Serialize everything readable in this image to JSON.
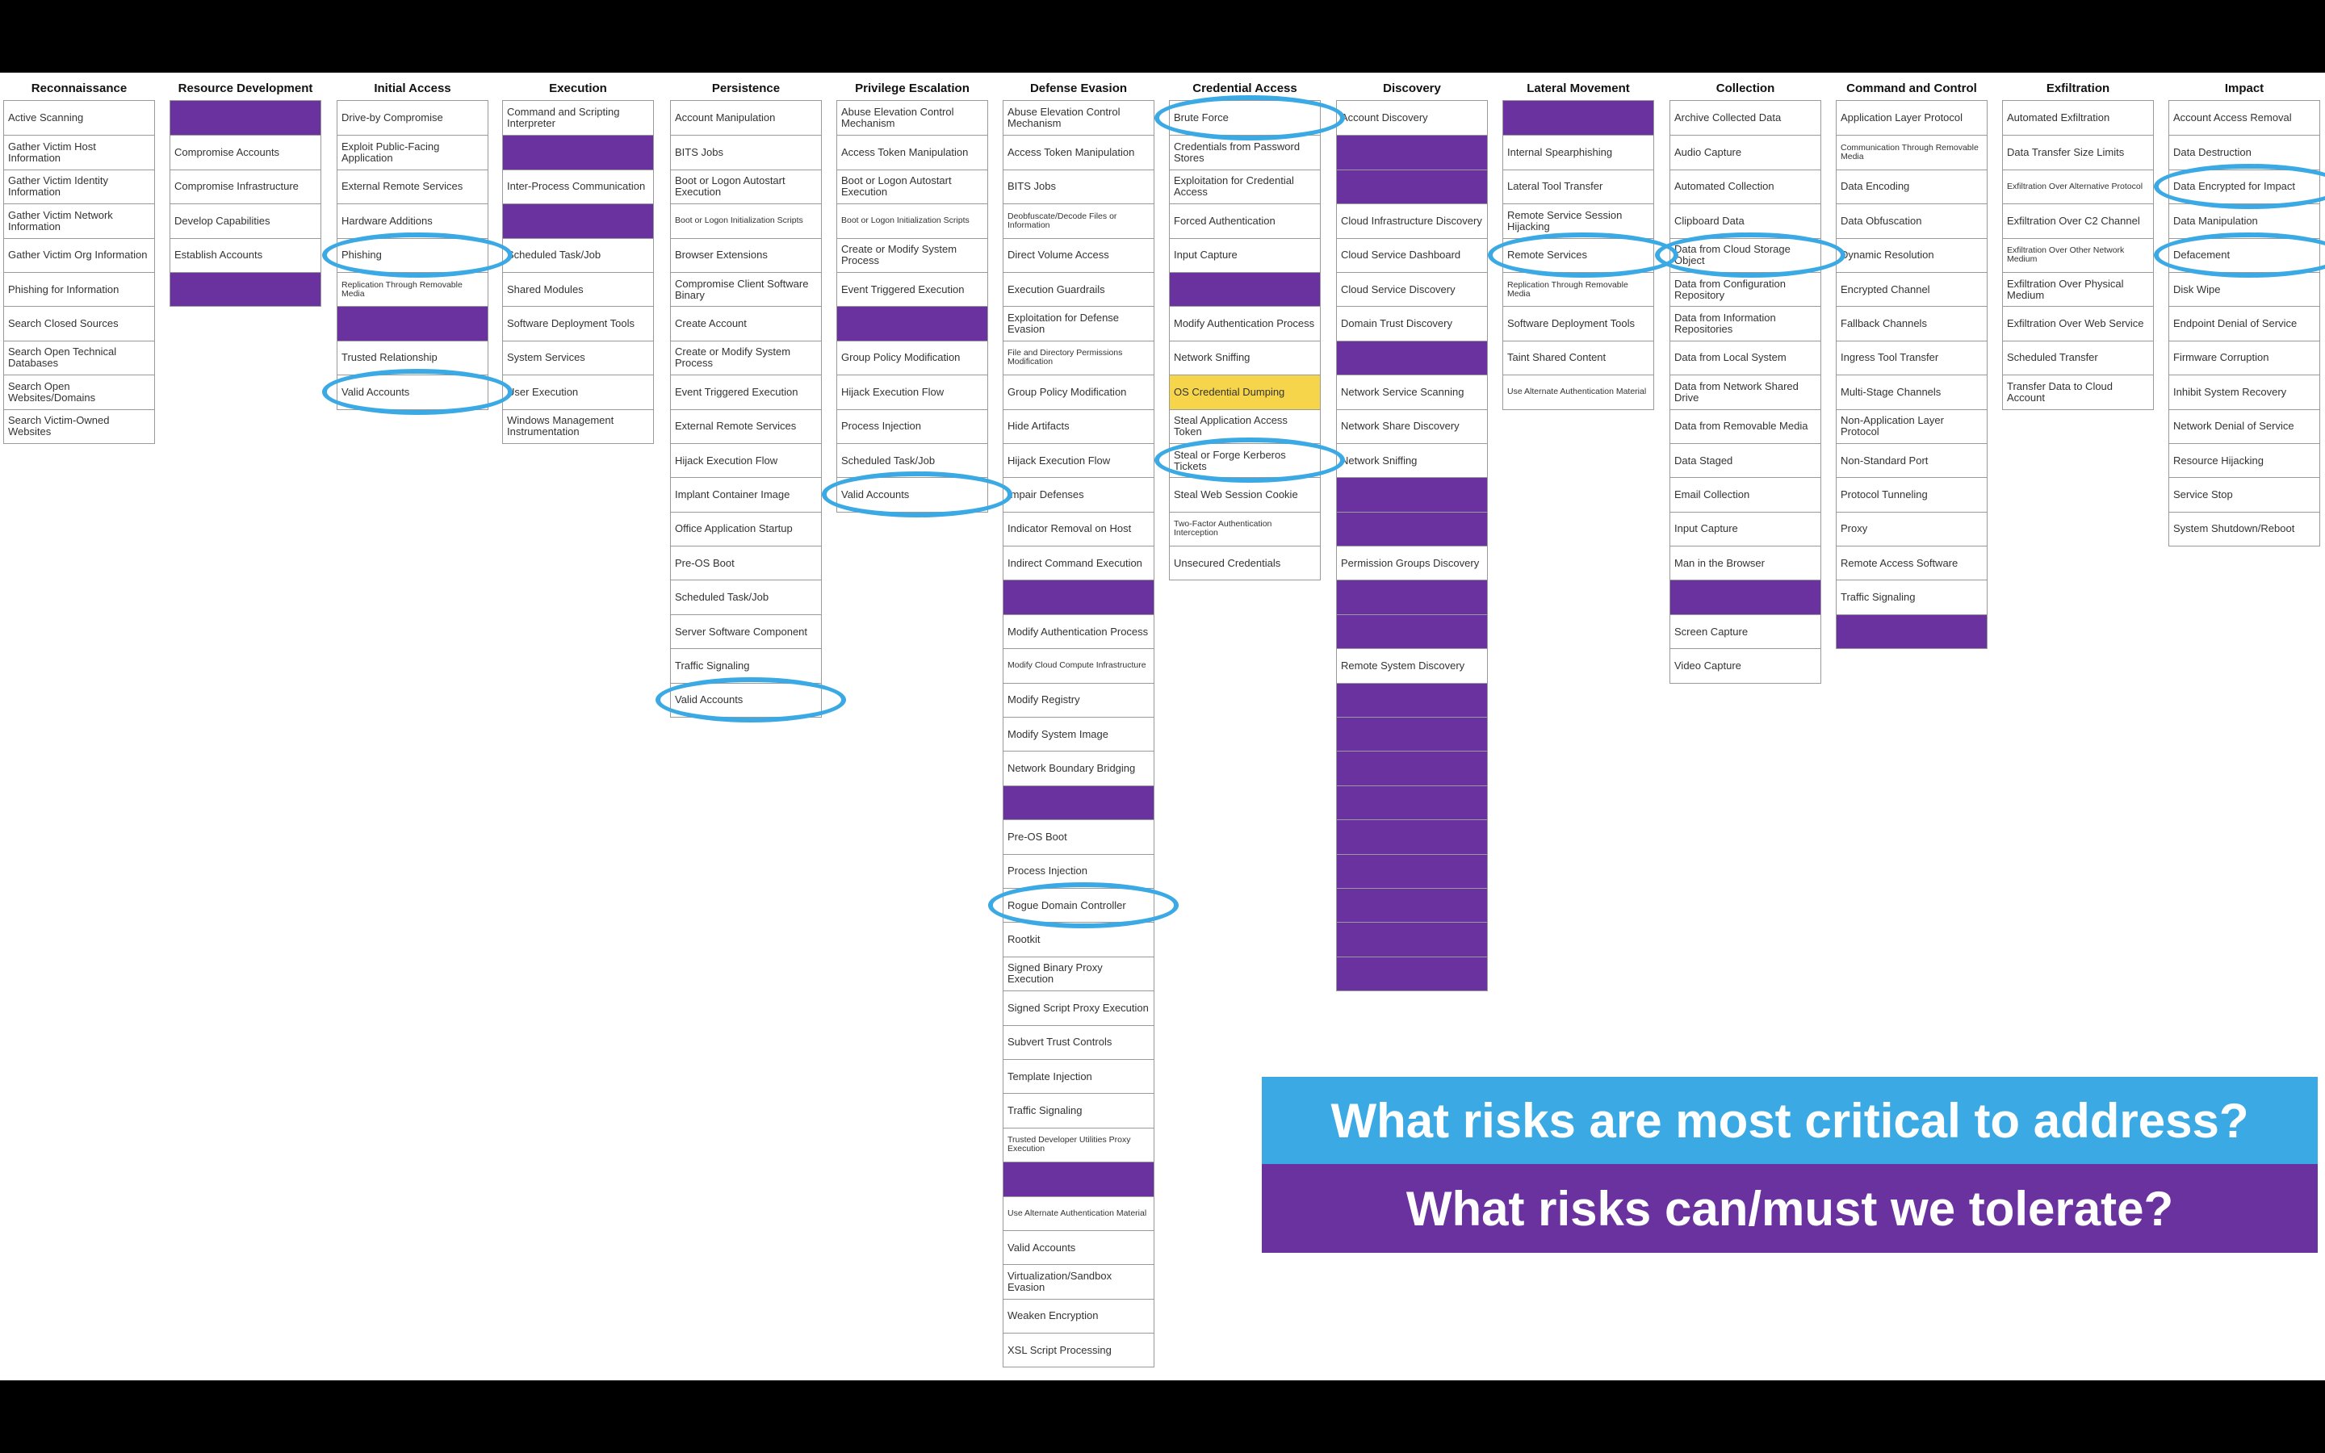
{
  "matrix": {
    "columns": [
      {
        "title": "Reconnaissance",
        "cells": [
          "Active Scanning",
          "Gather Victim Host Information",
          "Gather Victim Identity Information",
          "Gather Victim Network Information",
          "Gather Victim Org Information",
          "Phishing for Information",
          "Search Closed Sources",
          "Search Open Technical Databases",
          "Search Open Websites/Domains",
          "Search Victim-Owned Websites"
        ]
      },
      {
        "title": "Resource Development",
        "cells": [
          "",
          "Compromise Accounts",
          "Compromise Infrastructure",
          "Develop Capabilities",
          "Establish Accounts",
          ""
        ]
      },
      {
        "title": "Initial Access",
        "cells": [
          "Drive-by Compromise",
          "Exploit Public-Facing Application",
          "External Remote Services",
          "Hardware Additions",
          "Phishing",
          "Replication Through Removable Media",
          "",
          "Trusted Relationship",
          "Valid Accounts"
        ]
      },
      {
        "title": "Execution",
        "cells": [
          "Command and Scripting Interpreter",
          "",
          "Inter-Process Communication",
          "",
          "Scheduled Task/Job",
          "Shared Modules",
          "Software Deployment Tools",
          "System Services",
          "User Execution",
          "Windows Management Instrumentation"
        ]
      },
      {
        "title": "Persistence",
        "cells": [
          "Account Manipulation",
          "BITS Jobs",
          "Boot or Logon Autostart Execution",
          "Boot or Logon Initialization Scripts",
          "Browser Extensions",
          "Compromise Client Software Binary",
          "Create Account",
          "Create or Modify System Process",
          "Event Triggered Execution",
          "External Remote Services",
          "Hijack Execution Flow",
          "Implant Container Image",
          "Office Application Startup",
          "Pre-OS Boot",
          "Scheduled Task/Job",
          "Server Software Component",
          "Traffic Signaling",
          "Valid Accounts"
        ]
      },
      {
        "title": "Privilege Escalation",
        "cells": [
          "Abuse Elevation Control Mechanism",
          "Access Token Manipulation",
          "Boot or Logon Autostart Execution",
          "Boot or Logon Initialization Scripts",
          "Create or Modify System Process",
          "Event Triggered Execution",
          "",
          "Group Policy Modification",
          "Hijack Execution Flow",
          "Process Injection",
          "Scheduled Task/Job",
          "Valid Accounts"
        ]
      },
      {
        "title": "Defense Evasion",
        "cells": [
          "Abuse Elevation Control Mechanism",
          "Access Token Manipulation",
          "BITS Jobs",
          "Deobfuscate/Decode Files or Information",
          "Direct Volume Access",
          "Execution Guardrails",
          "Exploitation for Defense Evasion",
          "File and Directory Permissions Modification",
          "Group Policy Modification",
          "Hide Artifacts",
          "Hijack Execution Flow",
          "Impair Defenses",
          "Indicator Removal on Host",
          "Indirect Command Execution",
          "",
          "Modify Authentication Process",
          "Modify Cloud Compute Infrastructure",
          "Modify Registry",
          "Modify System Image",
          "Network Boundary Bridging",
          "",
          "Pre-OS Boot",
          "Process Injection",
          "Rogue Domain Controller",
          "Rootkit",
          "Signed Binary Proxy Execution",
          "Signed Script Proxy Execution",
          "Subvert Trust Controls",
          "Template Injection",
          "Traffic Signaling",
          "Trusted Developer Utilities Proxy Execution",
          "",
          "Use Alternate Authentication Material",
          "Valid Accounts",
          "Virtualization/Sandbox Evasion",
          "Weaken Encryption",
          "XSL Script Processing"
        ]
      },
      {
        "title": "Credential Access",
        "cells": [
          "Brute Force",
          "Credentials from Password Stores",
          "Exploitation for Credential Access",
          "Forced Authentication",
          "Input Capture",
          "",
          "Modify Authentication Process",
          "Network Sniffing",
          "OS Credential Dumping",
          "Steal Application Access Token",
          "Steal or Forge Kerberos Tickets",
          "Steal Web Session Cookie",
          "Two-Factor Authentication Interception",
          "Unsecured Credentials"
        ]
      },
      {
        "title": "Discovery",
        "cells": [
          "Account Discovery",
          "",
          "",
          "Cloud Infrastructure Discovery",
          "Cloud Service Dashboard",
          "Cloud Service Discovery",
          "Domain Trust Discovery",
          "",
          "Network Service Scanning",
          "Network Share Discovery",
          "Network Sniffing",
          "",
          "",
          "Permission Groups Discovery",
          "",
          "",
          "Remote System Discovery",
          "",
          "",
          "",
          "",
          "",
          "",
          "",
          "",
          ""
        ]
      },
      {
        "title": "Lateral Movement",
        "cells": [
          "",
          "Internal Spearphishing",
          "Lateral Tool Transfer",
          "Remote Service Session Hijacking",
          "Remote Services",
          "Replication Through Removable Media",
          "Software Deployment Tools",
          "Taint Shared Content",
          "Use Alternate Authentication Material"
        ]
      },
      {
        "title": "Collection",
        "cells": [
          "Archive Collected Data",
          "Audio Capture",
          "Automated Collection",
          "Clipboard Data",
          "Data from Cloud Storage Object",
          "Data from Configuration Repository",
          "Data from Information Repositories",
          "Data from Local System",
          "Data from Network Shared Drive",
          "Data from Removable Media",
          "Data Staged",
          "Email Collection",
          "Input Capture",
          "Man in the Browser",
          "",
          "Screen Capture",
          "Video Capture"
        ]
      },
      {
        "title": "Command and Control",
        "cells": [
          "Application Layer Protocol",
          "Communication Through Removable Media",
          "Data Encoding",
          "Data Obfuscation",
          "Dynamic Resolution",
          "Encrypted Channel",
          "Fallback Channels",
          "Ingress Tool Transfer",
          "Multi-Stage Channels",
          "Non-Application Layer Protocol",
          "Non-Standard Port",
          "Protocol Tunneling",
          "Proxy",
          "Remote Access Software",
          "Traffic Signaling",
          ""
        ]
      },
      {
        "title": "Exfiltration",
        "cells": [
          "Automated Exfiltration",
          "Data Transfer Size Limits",
          "Exfiltration Over Alternative Protocol",
          "Exfiltration Over C2 Channel",
          "Exfiltration Over Other Network Medium",
          "Exfiltration Over Physical Medium",
          "Exfiltration Over Web Service",
          "Scheduled Transfer",
          "Transfer Data to Cloud Account"
        ]
      },
      {
        "title": "Impact",
        "cells": [
          "Account Access Removal",
          "Data Destruction",
          "Data Encrypted for Impact",
          "Data Manipulation",
          "Defacement",
          "Disk Wipe",
          "Endpoint Denial of Service",
          "Firmware Corruption",
          "Inhibit System Recovery",
          "Network Denial of Service",
          "Resource Hijacking",
          "Service Stop",
          "System Shutdown/Reboot"
        ]
      }
    ]
  },
  "banner": {
    "question_critical": "What risks are most critical to address?",
    "question_tolerate": "What risks can/must we tolerate?"
  },
  "colors": {
    "highlight_ring": "#3aa9e4",
    "purple": "#6a329f",
    "yellow": "#f7d54a",
    "banner_blue": "#3aa9e4",
    "banner_purple": "#6a329f"
  }
}
